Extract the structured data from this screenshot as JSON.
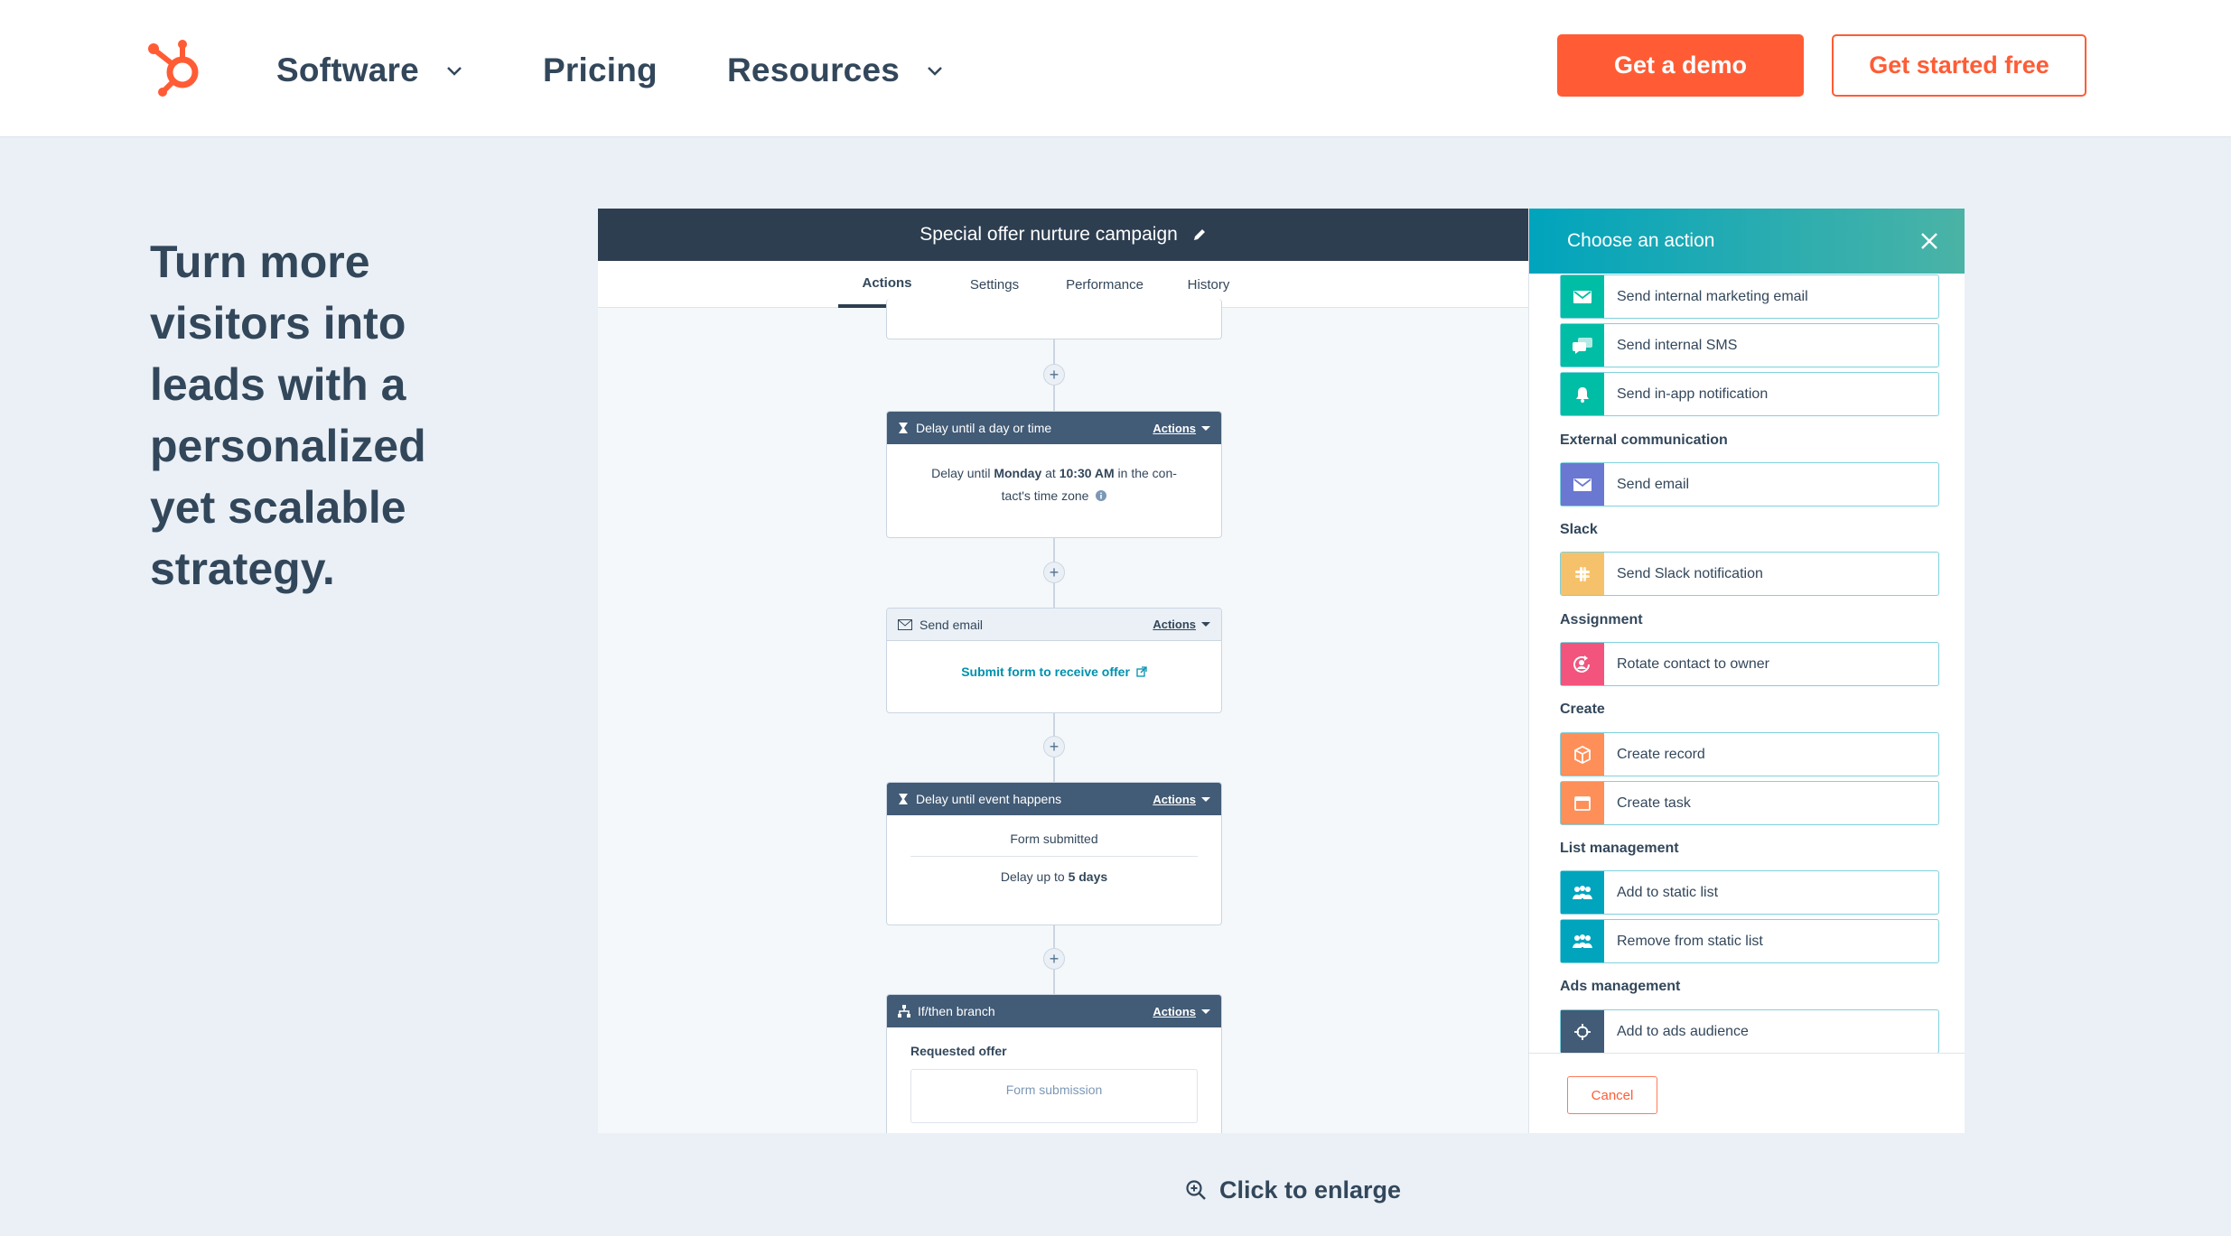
{
  "header": {
    "nav": [
      {
        "label": "Software",
        "has_dropdown": true
      },
      {
        "label": "Pricing",
        "has_dropdown": false
      },
      {
        "label": "Resources",
        "has_dropdown": true
      }
    ],
    "demo_button": "Get a demo",
    "free_button": "Get started free",
    "brand_color": "#ff5c35"
  },
  "headline": "Turn more visitors into leads with a personalized yet scalable strategy.",
  "mockup": {
    "title": "Special offer nurture campaign",
    "tabs": [
      "Actions",
      "Settings",
      "Performance",
      "History"
    ],
    "active_tab": "Actions",
    "cards": {
      "delay_time": {
        "title": "Delay until a day or time",
        "actions": "Actions",
        "line1_pre": "Delay until ",
        "day": "Monday",
        "at": " at ",
        "time": "10:30 AM",
        "line1_post": " in the con-",
        "line2": "tact's time zone"
      },
      "send_email": {
        "title": "Send email",
        "actions": "Actions",
        "link": "Submit form to receive offer"
      },
      "delay_event": {
        "title": "Delay until event happens",
        "actions": "Actions",
        "event": "Form submitted",
        "up_to": "Delay up to ",
        "days": "5 days"
      },
      "branch": {
        "title": "If/then branch",
        "actions": "Actions",
        "label": "Requested offer",
        "sub": "Form submission"
      }
    },
    "panel": {
      "title": "Choose an action",
      "items_top": [
        {
          "label": "Send internal marketing email",
          "icon": "email-icon",
          "color": "#00bda5"
        },
        {
          "label": "Send internal SMS",
          "icon": "chat-icon",
          "color": "#00bda5"
        },
        {
          "label": "Send in-app notification",
          "icon": "bell-icon",
          "color": "#00bda5"
        }
      ],
      "sections": [
        {
          "name": "External communication",
          "items": [
            {
              "label": "Send email",
              "icon": "email-icon",
              "color": "#6a78d1"
            }
          ]
        },
        {
          "name": "Slack",
          "items": [
            {
              "label": "Send Slack notification",
              "icon": "slack-icon",
              "color": "#f5c26b"
            }
          ]
        },
        {
          "name": "Assignment",
          "items": [
            {
              "label": "Rotate contact to owner",
              "icon": "rotate-user-icon",
              "color": "#f2547d"
            }
          ]
        },
        {
          "name": "Create",
          "items": [
            {
              "label": "Create record",
              "icon": "cube-icon",
              "color": "#ff8f59"
            },
            {
              "label": "Create task",
              "icon": "task-icon",
              "color": "#ff8f59"
            }
          ]
        },
        {
          "name": "List management",
          "items": [
            {
              "label": "Add to static list",
              "icon": "people-icon",
              "color": "#00a4bd"
            },
            {
              "label": "Remove from static list",
              "icon": "people-icon",
              "color": "#00a4bd"
            }
          ]
        },
        {
          "name": "Ads management",
          "items": [
            {
              "label": "Add to ads audience",
              "icon": "target-icon",
              "color": "#425b76"
            }
          ]
        }
      ],
      "cancel": "Cancel"
    }
  },
  "enlarge": "Click to enlarge"
}
